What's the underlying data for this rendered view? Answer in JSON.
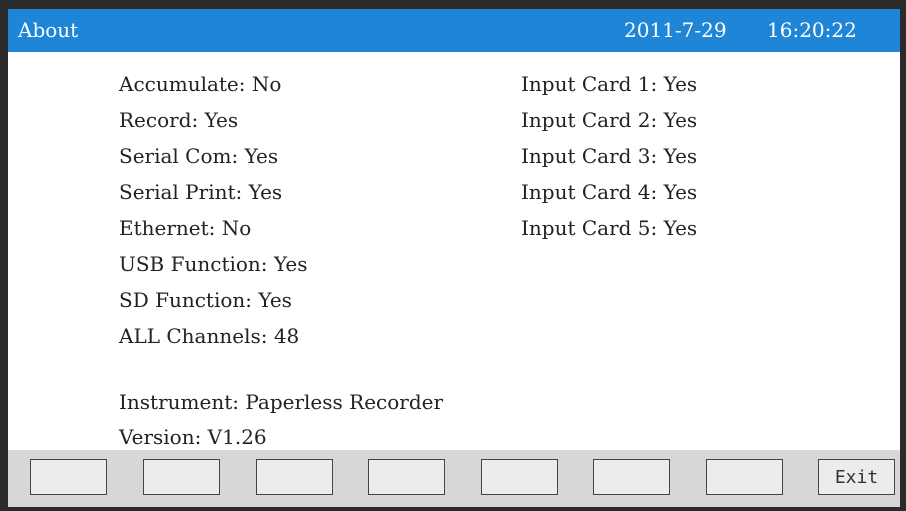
{
  "header": {
    "title": "About",
    "date": "2011-7-29",
    "time": "16:20:22"
  },
  "left_column": [
    "Accumulate: No",
    "Record: Yes",
    "Serial Com: Yes",
    "Serial Print: Yes",
    "Ethernet: No",
    "USB Function: Yes",
    "SD Function: Yes",
    "ALL Channels: 48"
  ],
  "right_column": [
    "Input Card 1: Yes",
    "Input Card 2: Yes",
    "Input Card 3: Yes",
    "Input Card 4: Yes",
    "Input Card 5: Yes"
  ],
  "instrument": "Instrument: Paperless Recorder",
  "version": "Version: V1.26",
  "footer": {
    "buttons": [
      "",
      "",
      "",
      "",
      "",
      "",
      "",
      "Exit"
    ]
  },
  "colors": {
    "titlebar": "#1f85d6",
    "frame": "#2a2a2a",
    "footer": "#d7d7d7"
  }
}
